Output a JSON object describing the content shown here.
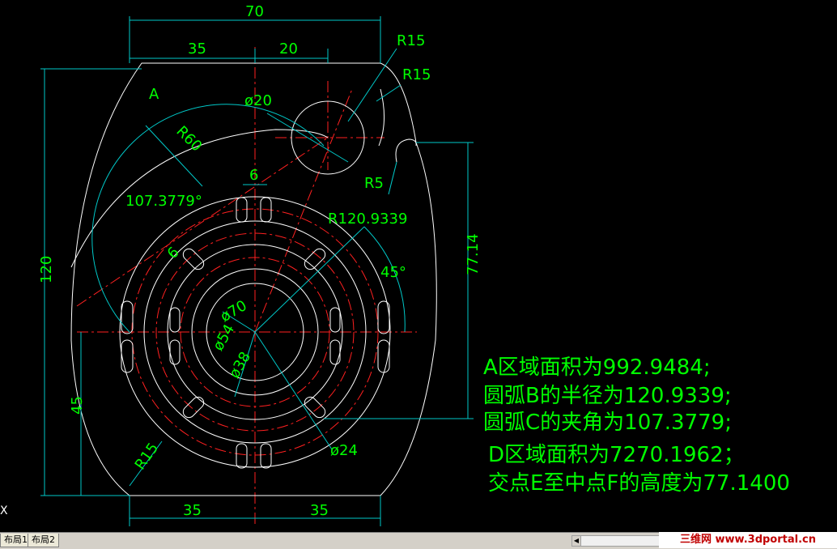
{
  "drawing": {
    "dim_labels": {
      "top_70": "70",
      "top_35": "35",
      "top_20": "20",
      "r15_a": "R15",
      "r15_b": "R15",
      "phi20": "ø20",
      "r60": "R60",
      "dim6_top": "6",
      "angle_107": "107.3779°",
      "r120": "R120.9339",
      "angle45": "45°",
      "dim6_side": "6",
      "phi70": "ø70",
      "phi54": "ø54",
      "phi38": "ø38",
      "phi24": "ø24",
      "r5": "R5",
      "r15_low": "R15",
      "left_120": "120",
      "left_45": "45",
      "right_7714": "77.14",
      "bot_35a": "35",
      "bot_35b": "35",
      "region_a": "A"
    },
    "notes": [
      "A区域面积为992.9484;",
      "圆弧B的半径为120.9339;",
      "圆弧C的夹角为107.3779;",
      "D区域面积为7270.1962；",
      "交点E至中点F的高度为77.1400"
    ],
    "colors": {
      "outline": "#ffffff",
      "dimension": "#00c8c8",
      "centerline": "#ff0000",
      "text": "#00ff00"
    }
  },
  "ucs_label": "X",
  "tabs": {
    "layout1": "布局1",
    "layout2": "布局2"
  },
  "watermark": "三维网 www.3dportal.cn"
}
